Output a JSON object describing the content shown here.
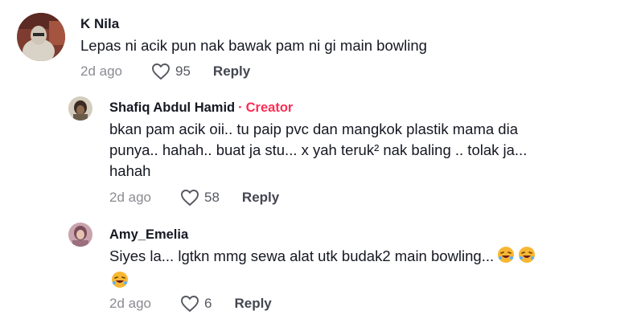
{
  "comments": [
    {
      "username": "K Nila",
      "text": "Lepas ni acik pun nak bawak pam ni gi main bowling",
      "date": "2d ago",
      "likes": "95",
      "reply_label": "Reply",
      "colors": {
        "avatar_bg": "#7a3a30"
      }
    },
    {
      "username": "Shafiq Abdul Hamid",
      "separator": "·",
      "role": "Creator",
      "text_lines": [
        "bkan pam acik oii.. tu paip pvc dan mangkok plastik mama dia",
        "punya.. hahah.. buat ja stu... x yah teruk² nak baling .. tolak ja...",
        "hahah"
      ],
      "date": "2d ago",
      "likes": "58",
      "reply_label": "Reply",
      "colors": {
        "avatar_bg": "#cfc7b8"
      }
    },
    {
      "username": "Amy_Emelia",
      "text_line1": "Siyes la... lgtkn mmg sewa alat utk budak2 main bowling...",
      "emoji": "rolling-on-floor-laughing",
      "date": "2d ago",
      "likes": "6",
      "reply_label": "Reply",
      "colors": {
        "avatar_bg": "#b88a96"
      }
    }
  ],
  "icons": {
    "like": "heart-outline-icon"
  },
  "accent_color": "#fe2c55"
}
